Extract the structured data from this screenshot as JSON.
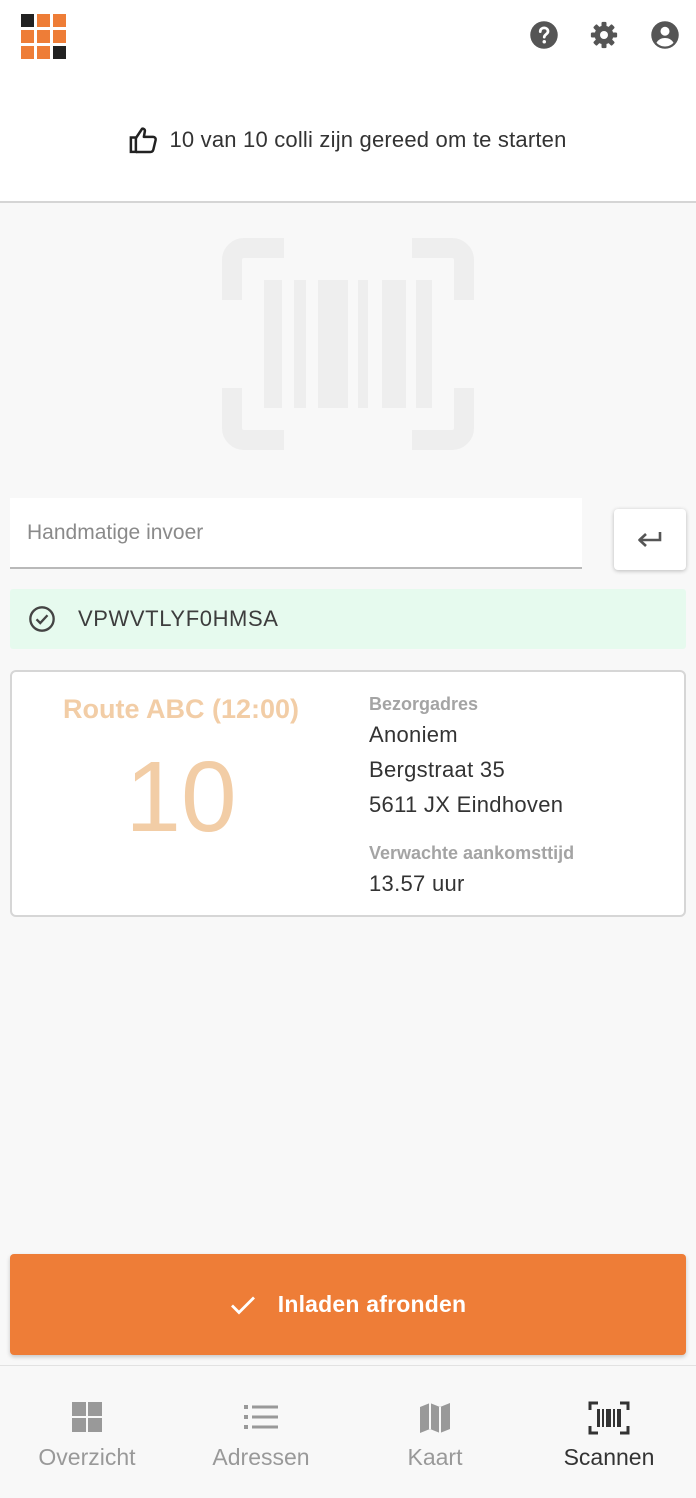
{
  "header": {
    "logo_icon": "app-grid-logo",
    "icons": [
      "help-icon",
      "settings-icon",
      "account-icon"
    ]
  },
  "status": {
    "icon": "thumbs-up-icon",
    "text": "10 van 10 colli zijn gereed om te starten"
  },
  "scanner": {
    "illustration_icon": "barcode-scan-icon",
    "input_placeholder": "Handmatige invoer",
    "input_value": "",
    "enter_icon": "enter-key-icon"
  },
  "scanned": {
    "icon": "check-circle-icon",
    "code": "VPWVTLYF0HMSA",
    "accent": "#e6faee"
  },
  "route_card": {
    "route_name": "Route ABC (12:00)",
    "count": "10",
    "delivery_label": "Bezorgadres",
    "name": "Anoniem",
    "street": "Bergstraat 35",
    "city": "5611 JX Eindhoven",
    "eta_label": "Verwachte aankomsttijd",
    "eta_value": "13.57 uur",
    "accent": "#f2cda6"
  },
  "actions": {
    "finish_label": "Inladen afronden",
    "finish_icon": "check-icon",
    "color": "#ee7d37"
  },
  "nav": {
    "items": [
      {
        "label": "Overzicht",
        "icon": "dashboard-icon",
        "active": false
      },
      {
        "label": "Adressen",
        "icon": "list-icon",
        "active": false
      },
      {
        "label": "Kaart",
        "icon": "map-icon",
        "active": false
      },
      {
        "label": "Scannen",
        "icon": "barcode-scan-icon",
        "active": true
      }
    ]
  }
}
